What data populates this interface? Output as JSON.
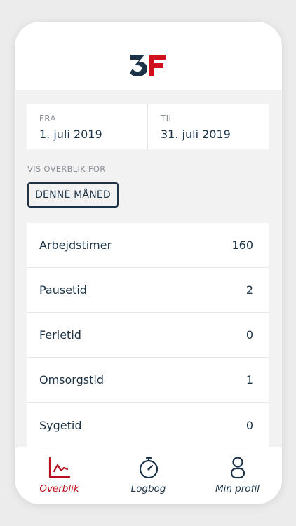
{
  "colors": {
    "brand_navy": "#1c3347",
    "brand_red": "#d0101f",
    "active_tab": "#b7101c",
    "muted_label": "#8a8f96"
  },
  "header": {
    "logo_text": "3F",
    "logo_icon": "3f-logo"
  },
  "date_range": {
    "from_label": "FRA",
    "from_value": "1. juli 2019",
    "to_label": "TIL",
    "to_value": "31. juli 2019"
  },
  "overview": {
    "label": "VIS OVERBLIK FOR",
    "period_button": "DENNE MÅNED"
  },
  "stats": [
    {
      "label": "Arbejdstimer",
      "value": "160"
    },
    {
      "label": "Pausetid",
      "value": "2"
    },
    {
      "label": "Ferietid",
      "value": "0"
    },
    {
      "label": "Omsorgstid",
      "value": "1"
    },
    {
      "label": "Sygetid",
      "value": "0"
    }
  ],
  "tabs": [
    {
      "label": "Overblik",
      "icon": "chart-icon",
      "active": true
    },
    {
      "label": "Logbog",
      "icon": "stopwatch-icon",
      "active": false
    },
    {
      "label": "Min profil",
      "icon": "person-icon",
      "active": false
    }
  ]
}
